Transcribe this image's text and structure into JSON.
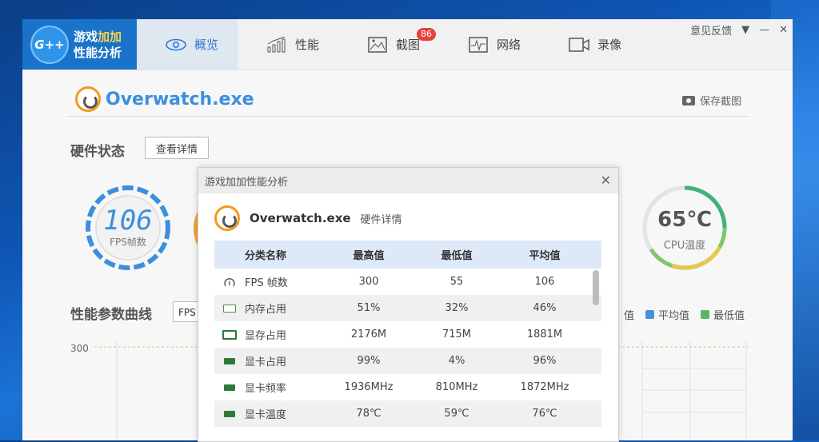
{
  "app": {
    "logo_text_line1_a": "游戏",
    "logo_text_line1_b": "加加",
    "logo_text_line2": "性能分析",
    "logo_badge": "G++"
  },
  "tabs": [
    {
      "label": "概览",
      "icon": "eye-icon"
    },
    {
      "label": "性能",
      "icon": "bar-chart-icon"
    },
    {
      "label": "截图",
      "icon": "image-icon",
      "badge": "86"
    },
    {
      "label": "网络",
      "icon": "pulse-icon"
    },
    {
      "label": "录像",
      "icon": "video-icon"
    }
  ],
  "window_controls": {
    "feedback": "意见反馈",
    "dropdown": "▼",
    "minimize": "—",
    "close": "✕"
  },
  "overview": {
    "process_name": "Overwatch.exe",
    "save_screenshot": "保存截图",
    "hardware_title": "硬件状态",
    "detail_button": "查看详情",
    "fps_value": "106",
    "fps_label": "FPS帧数",
    "cpu_value": "65℃",
    "cpu_label": "CPU温度",
    "curve_title": "性能参数曲线",
    "curve_select": "FPS",
    "legend_partial": "值",
    "legend_avg": "平均值",
    "legend_min": "最低值",
    "chart_ytick": "300"
  },
  "colors": {
    "accent": "#3c8fdc",
    "avg": "#4a90d9",
    "min": "#5cb56a",
    "orange": "#f2a33a"
  },
  "modal": {
    "title": "游戏加加性能分析",
    "close": "✕",
    "process_name": "Overwatch.exe",
    "subtitle": "硬件详情",
    "headers": [
      "分类名称",
      "最高值",
      "最低值",
      "平均值"
    ],
    "rows": [
      {
        "icon": "gauge-icon",
        "name": "FPS 帧数",
        "max": "300",
        "min": "55",
        "avg": "106"
      },
      {
        "icon": "memory-icon",
        "name": "内存占用",
        "max": "51%",
        "min": "32%",
        "avg": "46%"
      },
      {
        "icon": "vram-icon",
        "name": "显存占用",
        "max": "2176M",
        "min": "715M",
        "avg": "1881M"
      },
      {
        "icon": "gpu-icon",
        "name": "显卡占用",
        "max": "99%",
        "min": "4%",
        "avg": "96%"
      },
      {
        "icon": "gpu-icon",
        "name": "显卡频率",
        "max": "1936MHz",
        "min": "810MHz",
        "avg": "1872MHz"
      },
      {
        "icon": "gpu-icon",
        "name": "显卡温度",
        "max": "78℃",
        "min": "59℃",
        "avg": "76℃"
      }
    ]
  }
}
